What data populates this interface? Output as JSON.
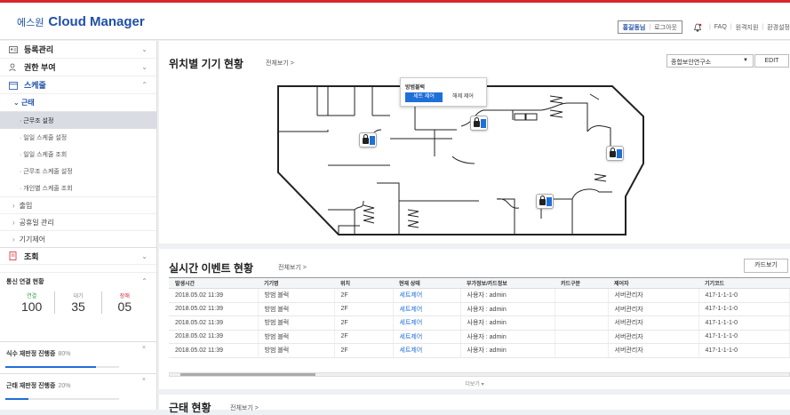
{
  "header": {
    "logo_prefix": "에스원",
    "logo_text": "Cloud Manager",
    "user_name": "홍길동님",
    "logout": "로그아웃",
    "faq": "FAQ",
    "remote": "원격지원",
    "settings": "환경설정"
  },
  "sidebar": {
    "menus": [
      {
        "label": "등록관리",
        "icon": "id-card-icon"
      },
      {
        "label": "권한 부여",
        "icon": "user-key-icon"
      },
      {
        "label": "스케줄",
        "icon": "calendar-icon"
      }
    ],
    "sub_head": "근태",
    "sub_items": [
      "· 근무조 설정",
      "· 일일 스케줄 설정",
      "· 일일 스케줄 조회",
      "· 근무조 스케줄 설정",
      "· 개인별 스케줄 조회"
    ],
    "sub_sections": [
      "출입",
      "공휴일 관리",
      "기기제어"
    ],
    "lookup": "조회",
    "conn_title": "통신 연결 현황",
    "conn": [
      {
        "label": "연결",
        "value": "100"
      },
      {
        "label": "대기",
        "value": "35"
      },
      {
        "label": "장애",
        "value": "05"
      }
    ],
    "progress": [
      {
        "title": "식수 재판정 진행중",
        "pct_label": "80%",
        "value": 0.8
      },
      {
        "title": "근태 재판정 진행중",
        "pct_label": "20%",
        "value": 0.2
      }
    ]
  },
  "location": {
    "title": "위치별 기기 현황",
    "view_all": "전체보기 >",
    "site": "종합보안연구소",
    "edit": "EDIT",
    "popup_title": "방범블럭",
    "popup_set": "세트 제어",
    "popup_release": "해제 제어"
  },
  "events": {
    "title": "실시간 이벤트 현황",
    "view_all": "전체보기 >",
    "card_button": "카드보기",
    "columns": [
      "발생시간",
      "기기명",
      "위치",
      "현재 상태",
      "부가정보/카드정보",
      "카드구분",
      "제어자",
      "기기코드"
    ],
    "rows": [
      [
        "2018.05.02 11:39",
        "방범 블럭",
        "2F",
        "세트제어",
        "사용자 : admin",
        "",
        "서버관리자",
        "417-1-1-1-0"
      ],
      [
        "2018.05.02 11:39",
        "방범 블럭",
        "2F",
        "세트제어",
        "사용자 : admin",
        "",
        "서버관리자",
        "417-1-1-1-0"
      ],
      [
        "2018.05.02 11:39",
        "방범 블럭",
        "2F",
        "세트제어",
        "사용자 : admin",
        "",
        "서버관리자",
        "417-1-1-1-0"
      ],
      [
        "2018.05.02 11:39",
        "방범 블럭",
        "2F",
        "세트제어",
        "사용자 : admin",
        "",
        "서버관리자",
        "417-1-1-1-0"
      ],
      [
        "2018.05.02 11:39",
        "방범 블럭",
        "2F",
        "세트제어",
        "사용자 : admin",
        "",
        "서버관리자",
        "417-1-1-1-0"
      ]
    ],
    "more": "더보기 ▾"
  },
  "attendance": {
    "title": "근태 현황",
    "view_all": "전체보기 >"
  }
}
